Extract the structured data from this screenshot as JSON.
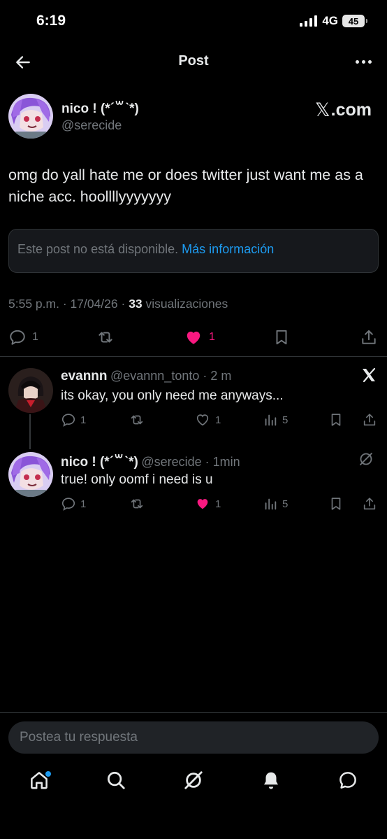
{
  "status_bar": {
    "time": "6:19",
    "network": "4G",
    "battery": "45"
  },
  "header": {
    "title": "Post"
  },
  "post": {
    "author_name": "nico ! (*´꒳ˋ*)",
    "author_handle": "@serecide",
    "source": "X.com",
    "text": "omg do yall hate me or does twitter just want me as a niche acc. hoollllyyyyyyy",
    "unavailable_text": "Este post no está disponible.",
    "unavailable_link": "Más información",
    "timestamp": "5:55 p.m. · 17/04/26 · ",
    "views_count": "33",
    "views_label": " visualizaciones",
    "replies": "1",
    "likes": "1"
  },
  "replies": [
    {
      "name": "evannn",
      "handle": "@evannn_tonto · 2 m",
      "text": "its okay, you only need me anyways...",
      "replies": "1",
      "likes": "1",
      "views": "5"
    },
    {
      "name": "nico ! (*´꒳ˋ*)",
      "handle": "@serecide · 1min",
      "text": "true! only oomf i need is u",
      "replies": "1",
      "likes": "1",
      "views": "5"
    }
  ],
  "composer": {
    "placeholder": "Postea tu respuesta"
  },
  "colors": {
    "accent": "#1d9bf0",
    "like": "#f91880",
    "muted": "#71767b",
    "text": "#e7e9ea",
    "background": "#000000"
  }
}
